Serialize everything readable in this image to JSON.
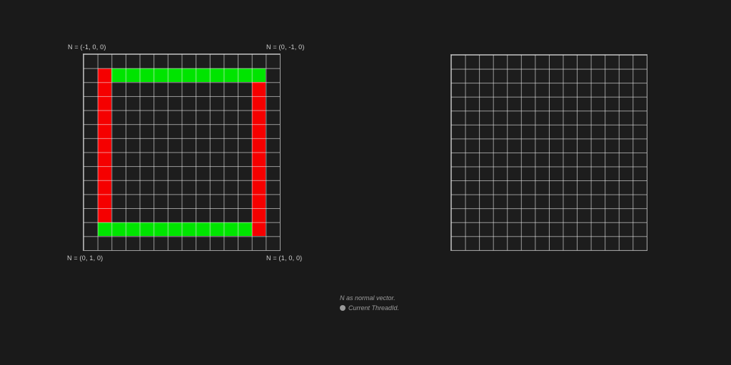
{
  "background": "#1a1a1a",
  "colors": {
    "red": "#f50000",
    "green": "#00e400",
    "grid_line": "#9c9c9c",
    "label_text": "#d2d2d2",
    "caption_text": "#9c9c9c",
    "bullet": "#9a9a9a"
  },
  "left_grid": {
    "rows": 14,
    "cols": 14,
    "labels": {
      "top_left": "N = (-1, 0, 0)",
      "top_right": "N = (0, -1, 0)",
      "bottom_left": "N = (0, 1, 0)",
      "bottom_right": "N = (1, 0, 0)"
    },
    "strips": [
      {
        "name": "green-top",
        "color": "green",
        "row_start": 1,
        "row_end": 1,
        "col_start": 2,
        "col_end": 12
      },
      {
        "name": "red-left",
        "color": "red",
        "row_start": 1,
        "row_end": 11,
        "col_start": 1,
        "col_end": 1
      },
      {
        "name": "green-bottom",
        "color": "green",
        "row_start": 12,
        "row_end": 12,
        "col_start": 1,
        "col_end": 11
      },
      {
        "name": "red-right",
        "color": "red",
        "row_start": 2,
        "row_end": 12,
        "col_start": 12,
        "col_end": 12
      }
    ]
  },
  "right_grid": {
    "rows": 14,
    "cols": 14,
    "strips": []
  },
  "caption": {
    "line1": "N as normal vector.",
    "line2": "Current ThreadId."
  }
}
